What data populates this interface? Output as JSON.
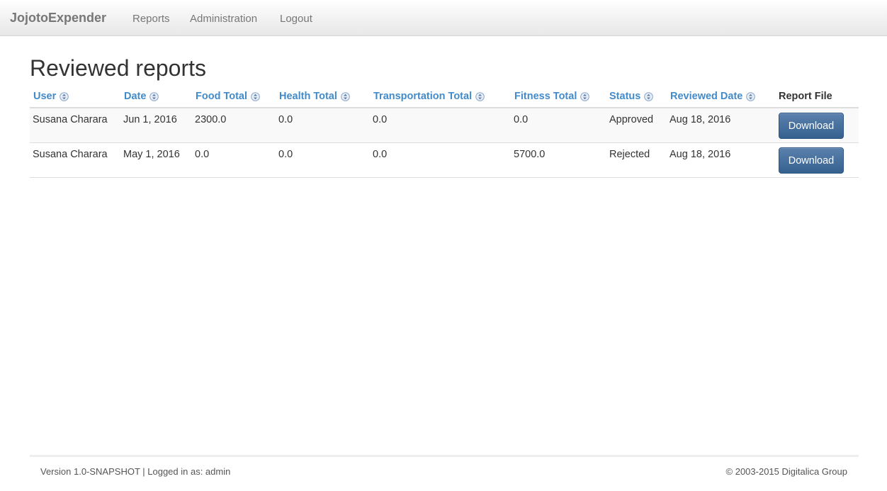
{
  "navbar": {
    "brand": "JojotoExpender",
    "links": [
      {
        "label": "Reports"
      },
      {
        "label": "Administration"
      },
      {
        "label": "Logout"
      }
    ]
  },
  "page": {
    "title": "Reviewed reports"
  },
  "table": {
    "columns": [
      {
        "label": "User",
        "sortable": true
      },
      {
        "label": "Date",
        "sortable": true
      },
      {
        "label": "Food Total",
        "sortable": true
      },
      {
        "label": "Health Total",
        "sortable": true
      },
      {
        "label": "Transportation Total",
        "sortable": true
      },
      {
        "label": "Fitness Total",
        "sortable": true
      },
      {
        "label": "Status",
        "sortable": true
      },
      {
        "label": "Reviewed Date",
        "sortable": true
      },
      {
        "label": "Report File",
        "sortable": false
      }
    ],
    "sort_icon": "sort-both-arrows-icon",
    "rows": [
      {
        "user": "Susana Charara",
        "date": "Jun 1, 2016",
        "food_total": "2300.0",
        "health_total": "0.0",
        "transportation_total": "0.0",
        "fitness_total": "0.0",
        "status": "Approved",
        "reviewed_date": "Aug 18, 2016",
        "download_label": "Download"
      },
      {
        "user": "Susana Charara",
        "date": "May 1, 2016",
        "food_total": "0.0",
        "health_total": "0.0",
        "transportation_total": "0.0",
        "fitness_total": "5700.0",
        "status": "Rejected",
        "reviewed_date": "Aug 18, 2016",
        "download_label": "Download"
      }
    ]
  },
  "footer": {
    "left": "Version 1.0-SNAPSHOT | Logged in as: admin",
    "right": "© 2003-2015  Digitalica Group"
  },
  "colors": {
    "link": "#428bca",
    "button": "#3b6797",
    "text": "#333333"
  }
}
